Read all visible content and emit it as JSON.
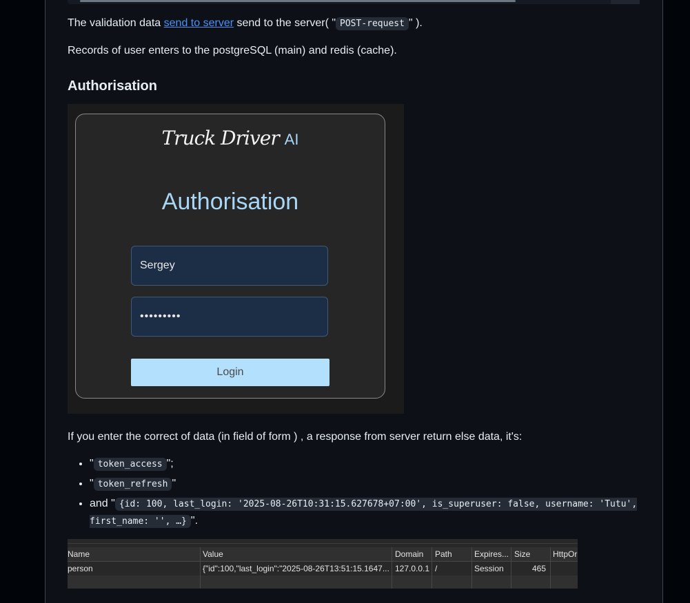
{
  "intro": {
    "prefix": "The validation data ",
    "link_text": "send to server",
    "middle": " send to the server( \"",
    "code": "POST-request",
    "suffix": "\" )."
  },
  "records_text": "Records of user enters to the postgreSQL (main) and redis (cache).",
  "section_title": "Authorisation",
  "login_shot": {
    "brand": "Truck Driver",
    "brand_ai": "AI",
    "title": "Authorisation",
    "username_value": "Sergey",
    "password_value": "•••••••••",
    "login_label": "Login",
    "colors": {
      "accent": "#a9d6f5",
      "button": "#b3e0fc",
      "field": "#1c2e45"
    }
  },
  "response_text": "If you enter the correct of data (in field of form ) , a response from server return else data, it's:",
  "tokens": {
    "item1_code": "token_access",
    "item1_suffix": "\";",
    "item2_code": "token_refresh",
    "item2_suffix": "\"",
    "item3_prefix": "and \"",
    "item3_code": "{id: 100, last_login: '2025-08-26T10:31:15.627678+07:00', is_superuser: false, username: 'Tutu', first_name: '', …}",
    "item3_suffix": "\".",
    "quote": "\""
  },
  "cookies": {
    "columns": [
      "Name",
      "Value",
      "Domain",
      "Path",
      "Expires...",
      "Size",
      "HttpOr"
    ],
    "rows": [
      [
        "person",
        "{\"id\":100,\"last_login\":\"2025-08-26T13:51:15.1647...",
        "127.0.0.1",
        "/",
        "Session",
        "465",
        ""
      ]
    ]
  }
}
